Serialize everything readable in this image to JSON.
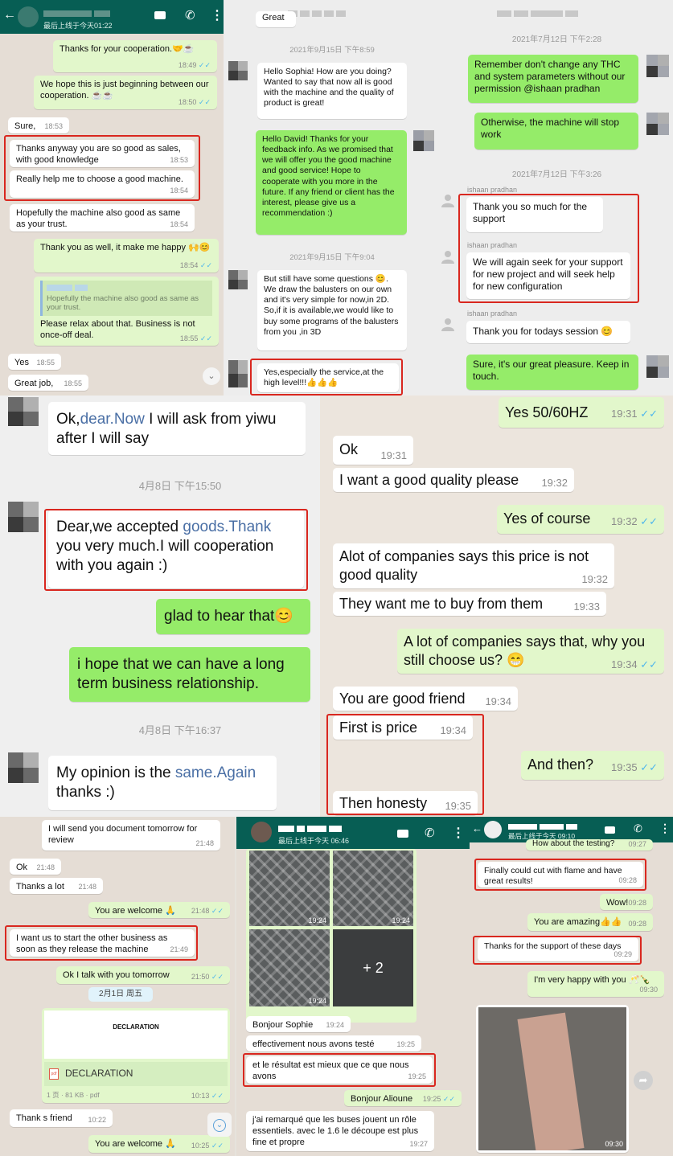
{
  "panel1": {
    "header": {
      "status": "最后上线于今天01:22"
    },
    "messages": [
      {
        "text": "Thanks for your cooperation.🤝☕",
        "time": "18:49"
      },
      {
        "text": "We hope this is just beginning between our cooperation. ☕☕",
        "time": "18:50"
      },
      {
        "text": "Sure,",
        "time": "18:53"
      },
      {
        "text": "Thanks anyway you are so good as sales, with good knowledge",
        "time": "18:53"
      },
      {
        "text": "Really help me to choose a good machine.",
        "time": "18:54"
      },
      {
        "text": "Hopefully the machine also good as same as your trust.",
        "time": "18:54"
      },
      {
        "text": "Thank you as well, it make me happy 🙌😊",
        "time": "18:54"
      },
      {
        "quote": "Hopefully the machine also good as same as your trust.",
        "text": "Please relax about that. Business is not once-off deal.",
        "time": "18:55"
      },
      {
        "text": "Yes",
        "time": "18:55"
      },
      {
        "text": "Great job,",
        "time": "18:55"
      }
    ]
  },
  "panel2": {
    "messages": [
      {
        "text": "Great"
      },
      {
        "time_label": "2021年9月15日 下午8:59"
      },
      {
        "text": "Hello Sophia! How are you doing? Wanted to say that now all is good  with the machine and the quality of product is great!"
      },
      {
        "text": "Hello David! Thanks for your feedback info. As we promised that we will offer you the good machine and good service! Hope to cooperate with you more in the future. If any friend or client has the interest, please give us a recommendation :)"
      },
      {
        "time_label": "2021年9月15日 下午9:04"
      },
      {
        "text": "But still have some questions 😊. We draw the balusters on our own and it's very simple for now,in 2D. So,if it is available,we would like to buy some programs of the balusters from you ,in 3D"
      },
      {
        "text": "Yes,especially the service,at the high level!!!👍👍👍"
      }
    ]
  },
  "panel3": {
    "messages": [
      {
        "time_label": "2021年7月12日 下午2:28"
      },
      {
        "text": "Remember don't change any THC and system parameters without our permission @ishaan pradhan"
      },
      {
        "text": "Otherwise, the machine will stop work"
      },
      {
        "time_label": "2021年7月12日 下午3:26"
      },
      {
        "sender": "ishaan pradhan",
        "text": "Thank you so much for the support"
      },
      {
        "sender": "ishaan pradhan",
        "text": "We will again seek for your support for new project and will seek help for new configuration"
      },
      {
        "sender": "ishaan pradhan",
        "text": "Thank you for todays session 😊"
      },
      {
        "text": "Sure, it's our great pleasure. Keep in touch."
      }
    ]
  },
  "panel4": {
    "messages": [
      {
        "pre": "Ok,",
        "link": "dear.Now",
        "post": " I will ask from yiwu after I will say"
      },
      {
        "time_label": "4月8日  下午15:50"
      },
      {
        "pre": "Dear,we accepted ",
        "link": "goods.Thank",
        "post": " you very much.I will cooperation with you again :)"
      },
      {
        "text": "glad to hear that😊"
      },
      {
        "text": "i hope that we can have a long term business relationship."
      },
      {
        "time_label": "4月8日  下午16:37"
      },
      {
        "pre": "My opinion is the ",
        "link": "same.Again",
        "post": " thanks :)"
      }
    ]
  },
  "panel5": {
    "messages": [
      {
        "text": "Yes 50/60HZ",
        "time": "19:31"
      },
      {
        "text": "Ok",
        "time": "19:31"
      },
      {
        "text": "I want a good quality please",
        "time": "19:32"
      },
      {
        "text": "Yes of course",
        "time": "19:32"
      },
      {
        "text": "Alot of companies says this price is not good quality",
        "time": "19:32"
      },
      {
        "text": "They want me to buy from them",
        "time": "19:33"
      },
      {
        "text": "A lot of companies says that, why you still choose us? 😁",
        "time": "19:34"
      },
      {
        "text": "You are good friend",
        "time": "19:34"
      },
      {
        "text": "First is price",
        "time": "19:34"
      },
      {
        "text": "And then?",
        "time": "19:35"
      },
      {
        "text": "Then honesty",
        "time": "19:35"
      }
    ]
  },
  "panel6": {
    "messages": [
      {
        "text": "I will send you document tomorrow for review",
        "time": "21:48"
      },
      {
        "text": "Ok",
        "time": "21:48"
      },
      {
        "text": "Thanks a lot",
        "time": "21:48"
      },
      {
        "text": "You are welcome 🙏",
        "time": "21:48"
      },
      {
        "text": "I want us to start the other business as soon as they release the machine",
        "time": "21:49"
      },
      {
        "text": "Ok I talk with you tomorrow",
        "time": "21:50"
      },
      {
        "date": "2月1日 周五"
      },
      {
        "doc_title": "DECLARATION",
        "doc_name": "DECLARATION",
        "doc_meta": "1 页 · 81 KB · pdf",
        "time": "10:13"
      },
      {
        "text": "Thank s friend",
        "time": "10:22"
      },
      {
        "text": "You are welcome 🙏",
        "time": "10:25"
      }
    ]
  },
  "panel7": {
    "header": {
      "status": "最后上线于今天 06:46"
    },
    "photos": [
      {
        "time": "19:24"
      },
      {
        "time": "19:24"
      },
      {
        "time": "19:24"
      },
      {
        "more": "+ 2"
      }
    ],
    "messages": [
      {
        "text": "Bonjour Sophie",
        "time": "19:24"
      },
      {
        "text": "effectivement nous avons testé",
        "time": "19:25"
      },
      {
        "text": "et le résultat est mieux que ce que nous avons",
        "time": "19:25"
      },
      {
        "text": "Bonjour Alioune",
        "time": "19:25"
      },
      {
        "text": "j'ai remarqué que les buses jouent un rôle essentiels. avec le 1.6 le découpe est plus fine et propre",
        "time": "19:27"
      }
    ]
  },
  "panel8": {
    "header": {
      "status": "最后上线于今天 09:10"
    },
    "messages": [
      {
        "text": "How about the testing?",
        "time": "09:27"
      },
      {
        "text": "Finally could cut with flame and have great results!",
        "time": "09:28"
      },
      {
        "text": "Wow!",
        "time": "09:28"
      },
      {
        "text": "You are amazing👍👍",
        "time": "09:28"
      },
      {
        "text": "Thanks for the support of these days",
        "time": "09:29"
      },
      {
        "text": "I'm very happy with you 🥂🍾",
        "time": "09:30"
      },
      {
        "photo_time": "09:30"
      }
    ]
  },
  "colors": {
    "whatsapp_bubble": "#e2f7cb",
    "wechat_bubble": "#95ec69",
    "whatsapp_header": "#075e54",
    "highlight": "#d9271f"
  }
}
